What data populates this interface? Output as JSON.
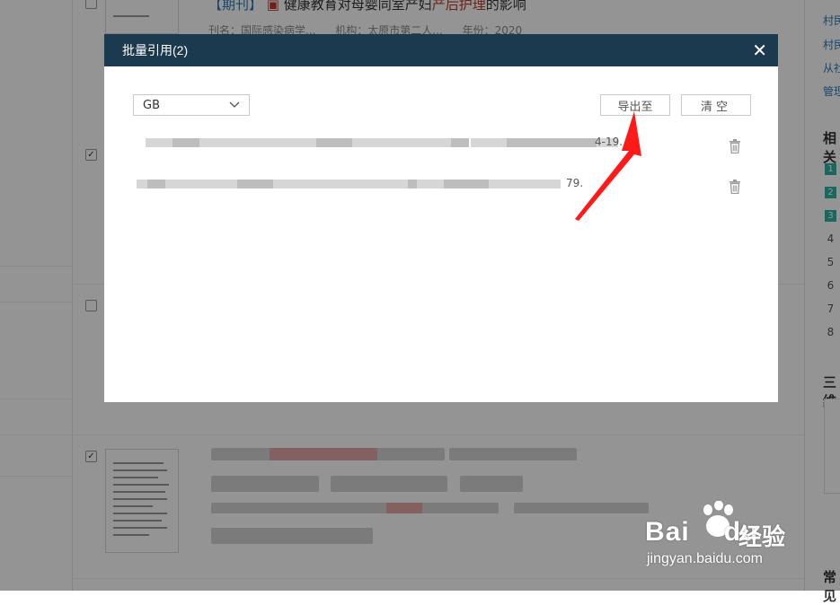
{
  "background": {
    "article": {
      "tag": "【期刊】",
      "title_pre": "健康教育对母婴同室产妇",
      "title_highlight": "产后护理",
      "title_post": "的影响",
      "journal": "刊名：国际感染病学...",
      "org": "机构：太原市第二人...",
      "year": "年份：2020"
    },
    "right_links": [
      "村民",
      "村民",
      "从社",
      "管理"
    ],
    "right_heading_1": "相关",
    "rank_numbers": [
      "1",
      "2",
      "3",
      "4",
      "5",
      "6",
      "7",
      "8"
    ],
    "right_heading_2": "三维",
    "right_heading_3": "常见"
  },
  "modal": {
    "title": "批量引用(2)",
    "close_glyph": "✕",
    "format_select": {
      "value": "GB"
    },
    "export_button": "导出至",
    "clear_button": "清空",
    "references": [
      {
        "tail": "4-19."
      },
      {
        "tail": "79."
      }
    ]
  },
  "watermark": {
    "brand": "Bai",
    "brand_suffix": "du",
    "product": "经验",
    "url": "jingyan.baidu.com"
  },
  "colors": {
    "modal_header": "#1c3a4f",
    "annotation_arrow": "#ff1a1a",
    "rank_badge": "#2bb3a3",
    "link": "#2a7ab8"
  }
}
